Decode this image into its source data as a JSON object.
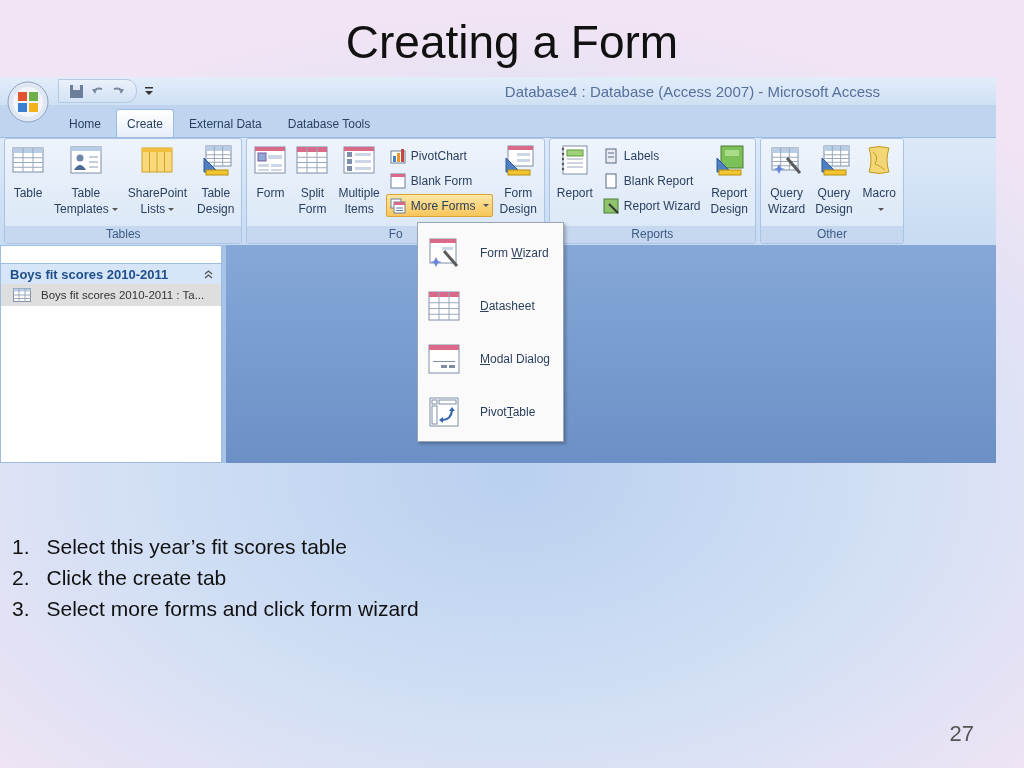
{
  "slide_title": "Creating a Form",
  "window": {
    "title": "Database4 : Database (Access 2007) - Microsoft Access"
  },
  "tabs": [
    {
      "label": "Home",
      "selected": false
    },
    {
      "label": "Create",
      "selected": true
    },
    {
      "label": "External Data",
      "selected": false
    },
    {
      "label": "Database Tools",
      "selected": false
    }
  ],
  "ribbon_groups": [
    {
      "label": "Tables",
      "items": [
        {
          "kind": "large",
          "label": "Table",
          "dropdown": false
        },
        {
          "kind": "large",
          "label": "Table\nTemplates",
          "dropdown": true
        },
        {
          "kind": "large",
          "label": "SharePoint\nLists",
          "dropdown": true
        },
        {
          "kind": "large",
          "label": "Table\nDesign",
          "dropdown": false
        }
      ]
    },
    {
      "label": "Fo",
      "items": [
        {
          "kind": "large",
          "label": "Form",
          "dropdown": false
        },
        {
          "kind": "large",
          "label": "Split\nForm",
          "dropdown": false
        },
        {
          "kind": "large",
          "label": "Multiple\nItems",
          "dropdown": false
        },
        {
          "kind": "stack",
          "items": [
            {
              "label": "PivotChart",
              "dropdown": false,
              "selected": false
            },
            {
              "label": "Blank Form",
              "dropdown": false,
              "selected": false
            },
            {
              "label": "More Forms",
              "dropdown": true,
              "selected": true
            }
          ]
        },
        {
          "kind": "large",
          "label": "Form\nDesign",
          "dropdown": false
        }
      ]
    },
    {
      "label": "Reports",
      "items": [
        {
          "kind": "large",
          "label": "Report",
          "dropdown": false
        },
        {
          "kind": "stack",
          "items": [
            {
              "label": "Labels",
              "dropdown": false,
              "selected": false
            },
            {
              "label": "Blank Report",
              "dropdown": false,
              "selected": false
            },
            {
              "label": "Report Wizard",
              "dropdown": false,
              "selected": false
            }
          ]
        },
        {
          "kind": "large",
          "label": "Report\nDesign",
          "dropdown": false
        }
      ]
    },
    {
      "label": "Other",
      "items": [
        {
          "kind": "large",
          "label": "Query\nWizard",
          "dropdown": false
        },
        {
          "kind": "large",
          "label": "Query\nDesign",
          "dropdown": false
        },
        {
          "kind": "large",
          "label": "Macro",
          "dropdown": true
        }
      ]
    }
  ],
  "nav_pane": {
    "header": "Boys fit scores 2010-2011",
    "expanded": true,
    "items": [
      {
        "label": "Boys fit scores 2010-2011 : Ta...",
        "selected": true
      }
    ]
  },
  "more_forms_menu": [
    {
      "before": "Form ",
      "key": "W",
      "after": "izard"
    },
    {
      "key": "D",
      "after": "atasheet"
    },
    {
      "key": "M",
      "after": "odal Dialog"
    },
    {
      "before": "Pivot",
      "key": "T",
      "after": "able"
    }
  ],
  "steps": [
    {
      "number": "1.",
      "text": "Select this year’s fit scores table"
    },
    {
      "number": "2.",
      "text": "Click the create tab"
    },
    {
      "number": "3.",
      "text": "Select more forms and click form wizard"
    }
  ],
  "page_number": "27"
}
